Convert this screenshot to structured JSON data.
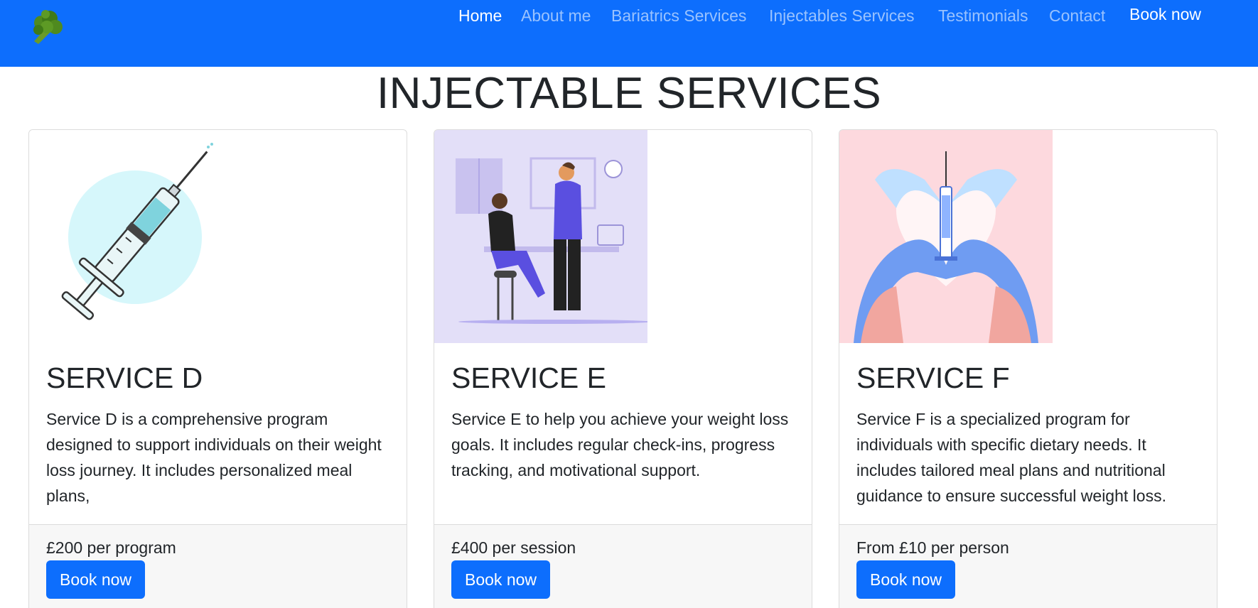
{
  "nav": {
    "logo_icon": "broccoli-icon",
    "links": [
      "Home",
      "About me",
      "Bariatrics Services",
      "Injectables Services",
      "Testimonials",
      "Contact"
    ],
    "active": "Home",
    "book_label": "Book now"
  },
  "page": {
    "title": "INJECTABLE SERVICES"
  },
  "cards": [
    {
      "image_icon": "syringe-illustration",
      "title": "SERVICE D",
      "text": "Service D is a comprehensive program designed to support individuals on their weight loss journey. It includes personalized meal plans,",
      "price": "£200 per program",
      "button": "Book now"
    },
    {
      "image_icon": "clinic-injection-illustration",
      "title": "SERVICE E",
      "text": "Service E to help you achieve your weight loss goals. It includes regular check-ins, progress tracking, and motivational support.",
      "price": "£400 per session",
      "button": "Book now"
    },
    {
      "image_icon": "gloved-hands-heart-syringe-illustration",
      "title": "SERVICE F",
      "text": "Service F is a specialized program for individuals with specific dietary needs. It includes tailored meal plans and nutritional guidance to ensure successful weight loss.",
      "price": "From £10 per person",
      "button": "Book now"
    }
  ],
  "colors": {
    "primary": "#0d6efd",
    "footer_bg": "#f7f7f7",
    "text": "#212529"
  }
}
